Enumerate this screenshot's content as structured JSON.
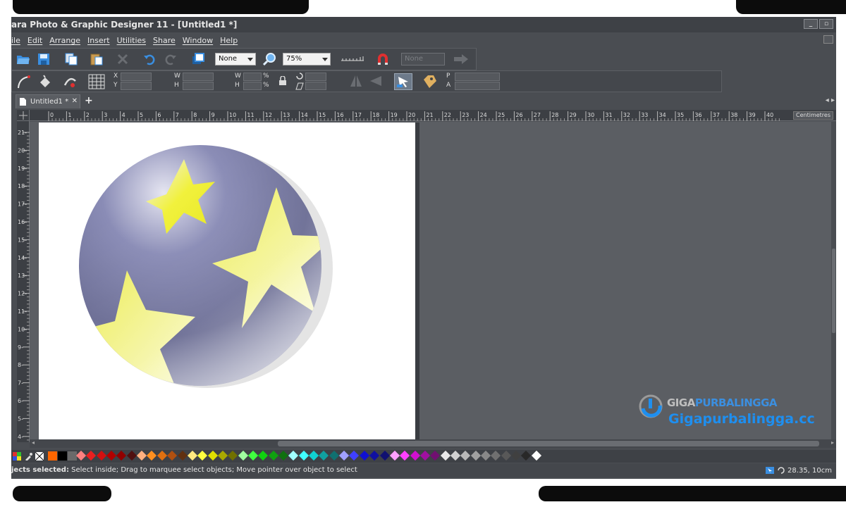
{
  "window": {
    "title": "ara Photo & Graphic Designer 11 - [Untitled1 *]",
    "min_label": "_",
    "restore_label": "▫"
  },
  "menu": [
    "ile",
    "Edit",
    "Arrange",
    "Insert",
    "Utilities",
    "Share",
    "Window",
    "Help"
  ],
  "toolbar": {
    "fill_select": "None",
    "zoom_value": "75%",
    "disabled_select": "None"
  },
  "infobar": {
    "x_label": "X",
    "y_label": "Y",
    "w_label": "W",
    "h_label": "H",
    "w2_label": "W",
    "h2_label": "H",
    "pct1": "%",
    "pct2": "%",
    "p_label": "P",
    "a_label": "A"
  },
  "tab": {
    "label": "Untitled1 *",
    "close": "✕",
    "add": "+",
    "scroll": "◂ ▸"
  },
  "ruler": {
    "units": "Centimetres",
    "h_ticks": [
      "0",
      "1",
      "2",
      "3",
      "4",
      "5",
      "6",
      "7",
      "8",
      "9",
      "10",
      "11",
      "12",
      "13",
      "14",
      "15",
      "16",
      "17",
      "18",
      "19",
      "20",
      "21",
      "22",
      "23",
      "24",
      "25",
      "26",
      "27",
      "28",
      "29",
      "30",
      "31",
      "32",
      "33",
      "34",
      "35",
      "36",
      "37",
      "38",
      "39",
      "40"
    ],
    "v_ticks": [
      "21",
      "20",
      "19",
      "18",
      "17",
      "16",
      "15",
      "14",
      "13",
      "12",
      "11",
      "10",
      "9",
      "8",
      "7",
      "6",
      "5",
      "4"
    ]
  },
  "palette_colors": [
    "#ff6600",
    "#000000",
    "#6a6a6a",
    "#ff8080",
    "#e82020",
    "#d01010",
    "#b00000",
    "#900000",
    "#501010",
    "#ffb080",
    "#ff9020",
    "#e07010",
    "#b05010",
    "#603010",
    "#ffe880",
    "#ffff40",
    "#e0e000",
    "#a8a800",
    "#707000",
    "#a0ffa0",
    "#40ff40",
    "#10d010",
    "#10a010",
    "#107010",
    "#a0ffff",
    "#40ffff",
    "#10d0d0",
    "#10a0a0",
    "#107070",
    "#a0a0ff",
    "#4040ff",
    "#1010d0",
    "#1010a0",
    "#101070",
    "#ffa0ff",
    "#ff40ff",
    "#d010d0",
    "#a010a0",
    "#701070",
    "#e8e8e8",
    "#d0d0d0",
    "#b8b8b8",
    "#a0a0a0",
    "#888888",
    "#707070",
    "#585858",
    "#404040",
    "#282828",
    "#ffffff"
  ],
  "status": {
    "message_bold": "jects selected:",
    "message": " Select inside; Drag to marquee select objects; Move pointer over object to select",
    "coords": "28.35, 10cm"
  },
  "watermark": {
    "brand_a": "GIGA",
    "brand_b": "PURBALINGGA",
    "url": "Gigapurbalingga.cc"
  }
}
